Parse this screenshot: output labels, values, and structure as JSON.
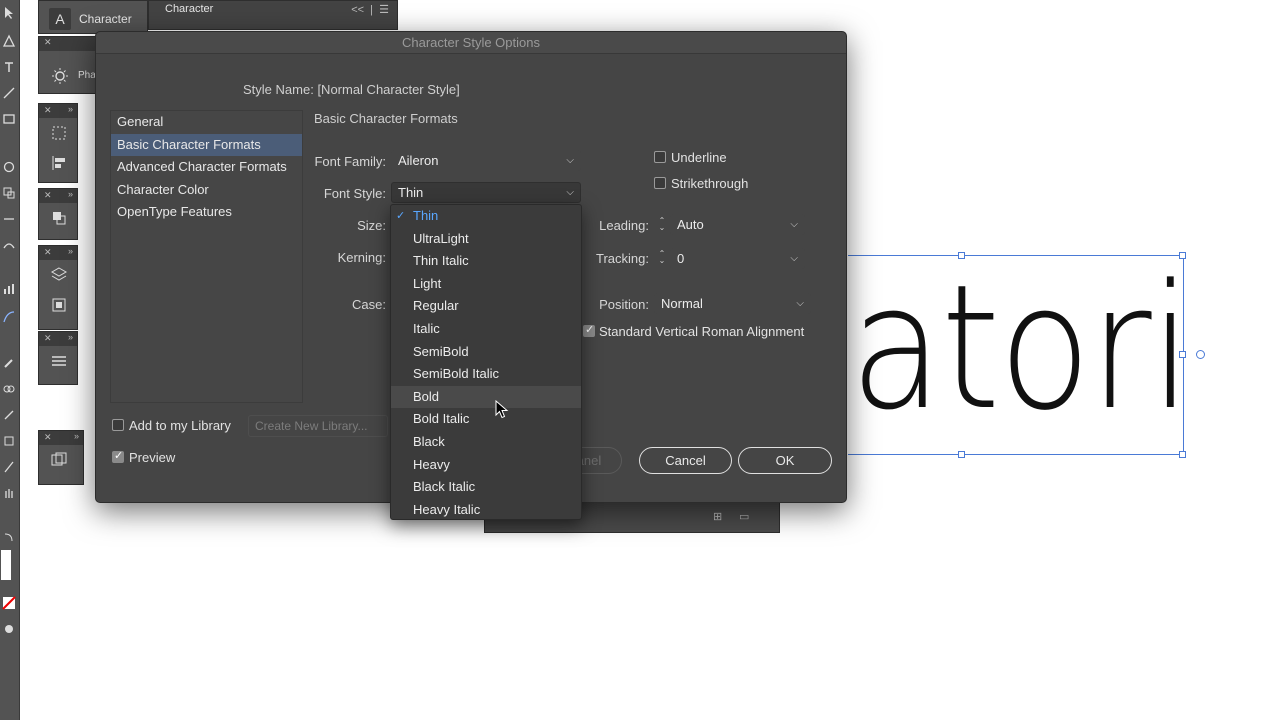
{
  "app": {
    "character_panel_title": "Character",
    "character_panel_tab": "Character",
    "paragraph_panel_label": "Pha"
  },
  "dialog": {
    "title": "Character Style Options",
    "style_name_label": "Style Name:",
    "style_name_value": "[Normal Character Style]",
    "categories": [
      {
        "label": "General",
        "active": false
      },
      {
        "label": "Basic Character Formats",
        "active": true
      },
      {
        "label": "Advanced Character Formats",
        "active": false
      },
      {
        "label": "Character Color",
        "active": false
      },
      {
        "label": "OpenType Features",
        "active": false
      }
    ],
    "section_title": "Basic Character Formats",
    "font_family": {
      "label": "Font Family:",
      "value": "Aileron"
    },
    "font_style": {
      "label": "Font Style:",
      "value": "Thin"
    },
    "size_label": "Size:",
    "kerning_label": "Kerning:",
    "case_label": "Case:",
    "leading": {
      "label": "Leading:",
      "value": "Auto"
    },
    "tracking": {
      "label": "Tracking:",
      "value": "0"
    },
    "position": {
      "label": "Position:",
      "value": "Normal"
    },
    "underline": {
      "label": "Underline",
      "checked": false
    },
    "strikethrough": {
      "label": "Strikethrough",
      "checked": false
    },
    "vertical_roman": {
      "label": "Standard Vertical Roman Alignment",
      "checked": true
    },
    "add_to_library": {
      "label": "Add to my Library",
      "checked": false
    },
    "create_library_label": "Create New Library...",
    "preview": {
      "label": "Preview",
      "checked": true
    },
    "hidden_button_label": "anel",
    "cancel_label": "Cancel",
    "ok_label": "OK"
  },
  "font_style_menu": {
    "items": [
      {
        "label": "Thin",
        "selected": true
      },
      {
        "label": "UltraLight"
      },
      {
        "label": "Thin Italic"
      },
      {
        "label": "Light"
      },
      {
        "label": "Regular"
      },
      {
        "label": "Italic"
      },
      {
        "label": "SemiBold"
      },
      {
        "label": "SemiBold Italic"
      },
      {
        "label": "Bold",
        "hover": true
      },
      {
        "label": "Bold Italic"
      },
      {
        "label": "Black"
      },
      {
        "label": "Heavy"
      },
      {
        "label": "Black Italic"
      },
      {
        "label": "Heavy Italic"
      }
    ]
  },
  "canvas": {
    "art_text": "atori"
  },
  "colors": {
    "selection_blue": "#4a7ad6",
    "menu_selected": "#5aa7ff",
    "dialog_bg": "#454545",
    "active_category": "#4b5d78"
  }
}
